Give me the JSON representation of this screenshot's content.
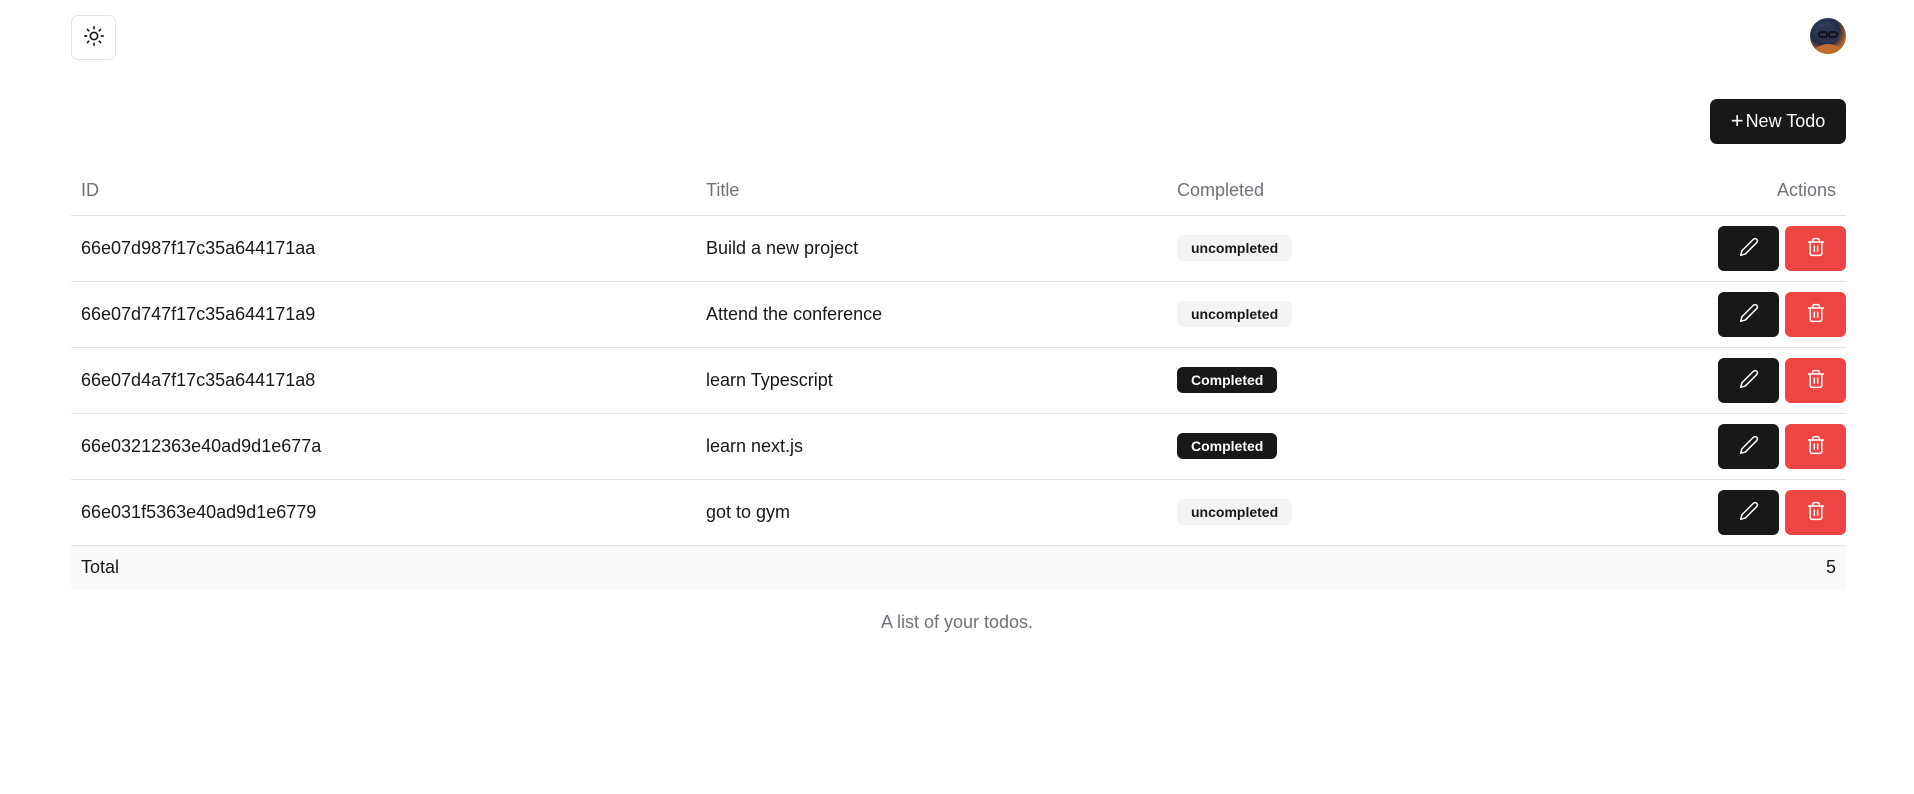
{
  "header": {
    "theme_toggle_icon": "sun-icon",
    "avatar_icon": "user-avatar"
  },
  "toolbar": {
    "new_todo_plus": "+",
    "new_todo_label": "New Todo"
  },
  "table": {
    "columns": {
      "id": "ID",
      "title": "Title",
      "completed": "Completed",
      "actions": "Actions"
    },
    "rows": [
      {
        "id": "66e07d987f17c35a644171aa",
        "title": "Build a new project",
        "status": "uncompleted",
        "completed": false
      },
      {
        "id": "66e07d747f17c35a644171a9",
        "title": "Attend the conference",
        "status": "uncompleted",
        "completed": false
      },
      {
        "id": "66e07d4a7f17c35a644171a8",
        "title": "learn Typescript",
        "status": "Completed",
        "completed": true
      },
      {
        "id": "66e03212363e40ad9d1e677a",
        "title": "learn next.js",
        "status": "Completed",
        "completed": true
      },
      {
        "id": "66e031f5363e40ad9d1e6779",
        "title": "got to gym",
        "status": "uncompleted",
        "completed": false
      }
    ],
    "footer": {
      "total_label": "Total",
      "total_value": "5"
    },
    "caption": "A list of your todos."
  },
  "colors": {
    "primary": "#18181b",
    "destructive": "#ef4444",
    "muted_text": "#71717a",
    "border": "#e4e4e7"
  }
}
